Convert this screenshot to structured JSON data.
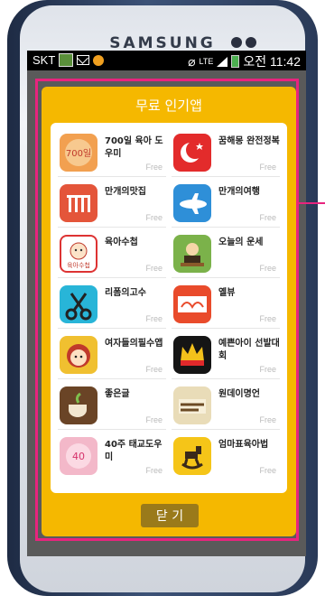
{
  "device": {
    "brand": "SAMSUNG"
  },
  "status_bar": {
    "carrier": "SKT",
    "network": "LTE",
    "time": "오전 11:42"
  },
  "dialog": {
    "title": "무료 인기앱",
    "close_label": "닫 기",
    "apps": [
      {
        "name": "700일 육아 도우미",
        "price": "Free",
        "icon": "700-days-icon"
      },
      {
        "name": "꿈해몽 완전정복",
        "price": "Free",
        "icon": "moon-icon"
      },
      {
        "name": "만개의맛집",
        "price": "Free",
        "icon": "restaurant-icon"
      },
      {
        "name": "만개의여행",
        "price": "Free",
        "icon": "airplane-icon"
      },
      {
        "name": "육아수첩",
        "price": "Free",
        "icon": "baby-notebook-icon"
      },
      {
        "name": "오늘의 운세",
        "price": "Free",
        "icon": "fortune-icon"
      },
      {
        "name": "리폼의고수",
        "price": "Free",
        "icon": "scissors-icon"
      },
      {
        "name": "옐뷰",
        "price": "Free",
        "icon": "review-icon"
      },
      {
        "name": "여자들의필수앱",
        "price": "Free",
        "icon": "girl-icon"
      },
      {
        "name": "예쁜아이 선발대회",
        "price": "Free",
        "icon": "crown-icon"
      },
      {
        "name": "좋은글",
        "price": "Free",
        "icon": "coffee-icon"
      },
      {
        "name": "원데이명언",
        "price": "Free",
        "icon": "quotes-icon"
      },
      {
        "name": "40주 태교도우미",
        "price": "Free",
        "icon": "40-weeks-icon"
      },
      {
        "name": "엄마표육아법",
        "price": "Free",
        "icon": "rocking-horse-icon"
      }
    ]
  },
  "colors": {
    "dialog_bg": "#f5b800",
    "highlight": "#e8247e",
    "close_button": "#9a7a1a"
  }
}
